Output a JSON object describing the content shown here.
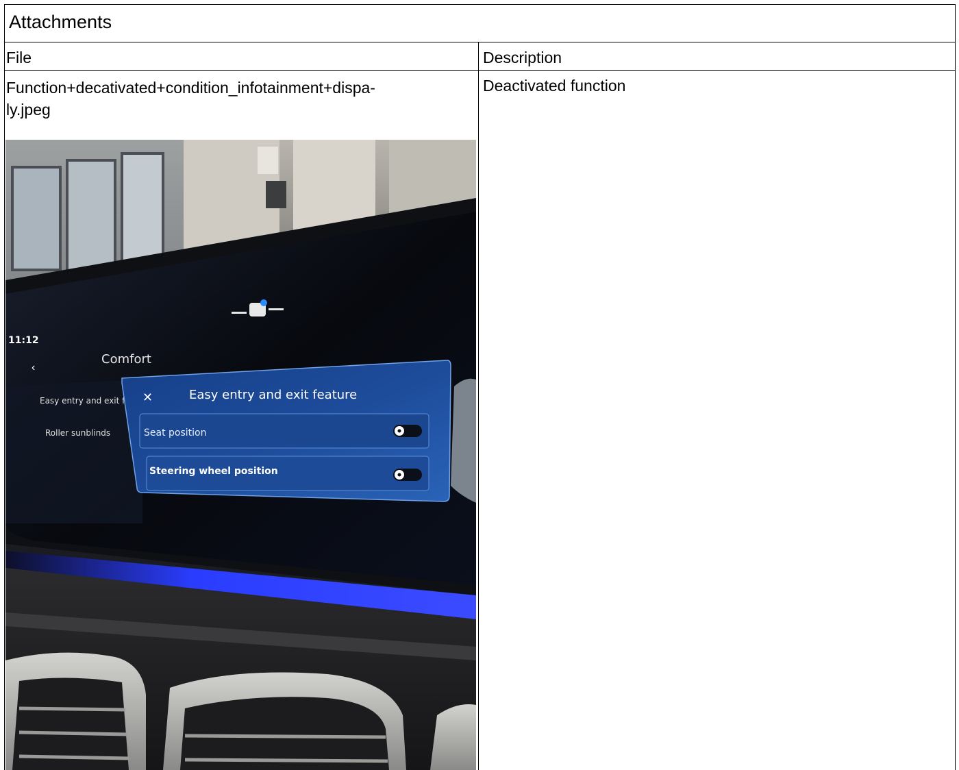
{
  "section": {
    "title": "Attachments"
  },
  "table": {
    "headers": {
      "file": "File",
      "description": "Description"
    },
    "rows": [
      {
        "file_name_line1": "Function+decativated+condition_infotainment+dispa-",
        "file_name_line2": "ly.jpeg",
        "description": "Deactivated function"
      }
    ]
  },
  "photo": {
    "screen": {
      "time": "11:12",
      "breadcrumb": "Comfort",
      "menu_items": [
        "Easy entry and exit fea",
        "Roller sunblinds"
      ],
      "dialog": {
        "title": "Easy entry and exit feature",
        "close_glyph": "✕",
        "options": [
          {
            "label": "Seat position",
            "state": "off"
          },
          {
            "label": "Steering wheel position",
            "state": "off"
          }
        ]
      }
    },
    "colors": {
      "dialog_blue": "#1e4d9c",
      "ambient_light": "#2a3dff",
      "display_black": "#07090e"
    }
  }
}
